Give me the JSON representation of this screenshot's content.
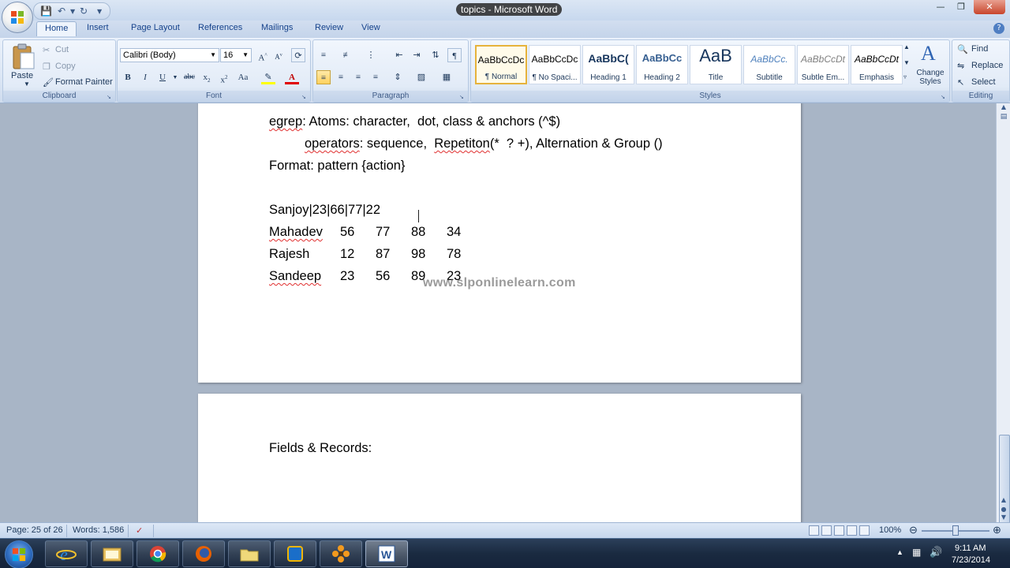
{
  "window": {
    "title": "topics - Microsoft Word",
    "qat_icons": [
      "save-icon",
      "undo-icon",
      "redo-icon",
      "customize-icon"
    ]
  },
  "ribbon": {
    "tabs": [
      "Home",
      "Insert",
      "Page Layout",
      "References",
      "Mailings",
      "Review",
      "View"
    ],
    "active_tab": "Home",
    "clipboard": {
      "label": "Clipboard",
      "paste": "Paste",
      "cut": "Cut",
      "copy": "Copy",
      "format_painter": "Format Painter"
    },
    "font": {
      "label": "Font",
      "font_name": "Calibri (Body)",
      "font_size": "16"
    },
    "paragraph": {
      "label": "Paragraph"
    },
    "styles": {
      "label": "Styles",
      "items": [
        {
          "sample": "AaBbCcDc",
          "name": "¶ Normal"
        },
        {
          "sample": "AaBbCcDc",
          "name": "¶ No Spaci..."
        },
        {
          "sample": "AaBbC(",
          "name": "Heading 1"
        },
        {
          "sample": "AaBbCc",
          "name": "Heading 2"
        },
        {
          "sample": "AaB",
          "name": "Title"
        },
        {
          "sample": "AaBbCc.",
          "name": "Subtitle"
        },
        {
          "sample": "AaBbCcDt",
          "name": "Subtle Em..."
        },
        {
          "sample": "AaBbCcDt",
          "name": "Emphasis"
        }
      ],
      "change_styles": "Change Styles"
    },
    "editing": {
      "label": "Editing",
      "find": "Find",
      "replace": "Replace",
      "select": "Select"
    }
  },
  "document": {
    "page1": {
      "line1": {
        "w1": "egrep",
        "rest": ": Atoms: character,  dot, class & anchors (^$)"
      },
      "line2": {
        "w1": "operators",
        "mid": ": sequence,  ",
        "w2": "Repetiton",
        "rest": "(*  ? +), Alternation & Group ()"
      },
      "line3": "Format: pattern {action}",
      "line4": "Sanjoy|23|66|77|22",
      "rows": [
        {
          "name": "Mahadev",
          "v": [
            "56",
            "77",
            "88",
            "34"
          ]
        },
        {
          "name": "Rajesh",
          "v": [
            "12",
            "87",
            "98",
            "78"
          ]
        },
        {
          "name": "Sandeep",
          "v": [
            "23",
            "56",
            "89",
            "23"
          ]
        }
      ]
    },
    "page2": {
      "line1": "Fields & Records:"
    },
    "watermark": "www.slponlinelearn.com"
  },
  "statusbar": {
    "page": "Page: 25 of 26",
    "words": "Words: 1,586",
    "zoom": "100%"
  },
  "taskbar": {
    "apps": [
      "internet-explorer-icon",
      "file-explorer-icon",
      "chrome-icon",
      "firefox-icon",
      "folder-icon",
      "virtualbox-icon",
      "flower-app-icon",
      "word-icon"
    ],
    "time": "9:11 AM",
    "date": "7/23/2014"
  },
  "colors": {
    "ribbon_text": "#1e395b",
    "doc_bg": "#a8b5c6",
    "squiggle": "#e03030"
  }
}
